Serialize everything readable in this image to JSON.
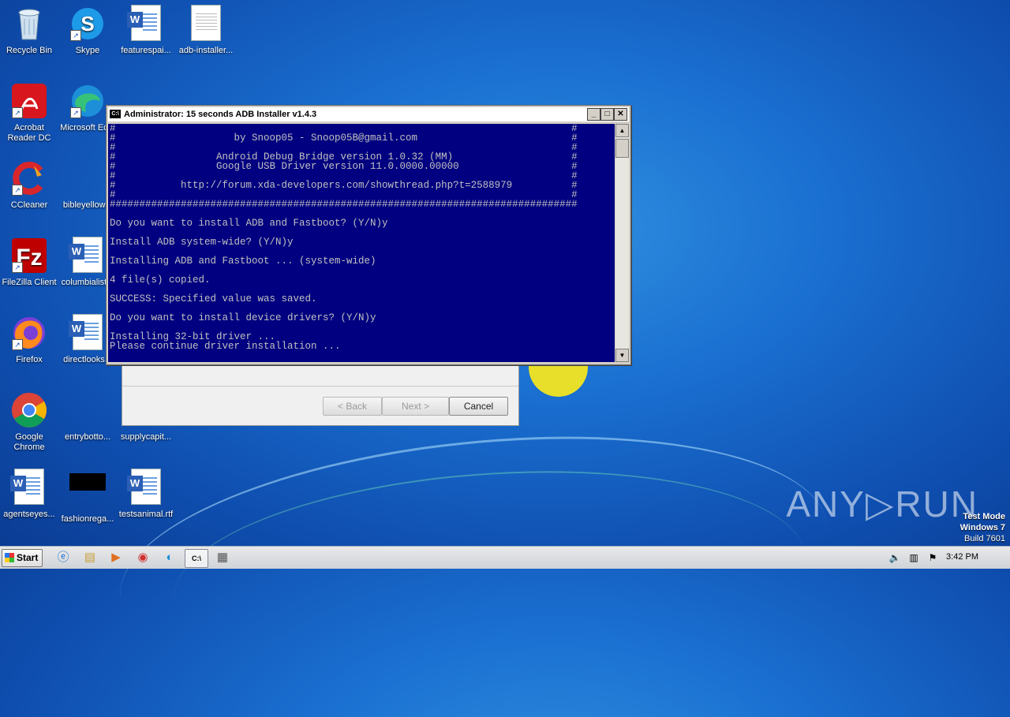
{
  "desktop": {
    "icons": [
      {
        "label": "Recycle Bin",
        "icon": "recycle-bin-icon"
      },
      {
        "label": "Skype",
        "icon": "skype-icon"
      },
      {
        "label": "featurespai...",
        "icon": "word-document-icon"
      },
      {
        "label": "adb-installer...",
        "icon": "text-file-icon"
      },
      {
        "label": "Acrobat Reader DC",
        "icon": "acrobat-icon"
      },
      {
        "label": "Microsoft Ec...",
        "icon": "edge-icon"
      },
      {
        "label": "CCleaner",
        "icon": "ccleaner-icon"
      },
      {
        "label": "bibleyellow...",
        "icon": "file-icon"
      },
      {
        "label": "FileZilla Client",
        "icon": "filezilla-icon"
      },
      {
        "label": "columbialist...",
        "icon": "word-document-icon"
      },
      {
        "label": "Firefox",
        "icon": "firefox-icon"
      },
      {
        "label": "directlooks...",
        "icon": "word-document-icon"
      },
      {
        "label": "Google Chrome",
        "icon": "chrome-icon"
      },
      {
        "label": "entrybotto...",
        "icon": "file-icon"
      },
      {
        "label": "supplycapit...",
        "icon": "file-icon"
      },
      {
        "label": "agentseyes...",
        "icon": "word-document-icon"
      },
      {
        "label": "fashionrega...",
        "icon": "black-file-icon"
      },
      {
        "label": "testsanimal.rtf",
        "icon": "word-document-icon"
      }
    ]
  },
  "console": {
    "title": "Administrator:  15 seconds ADB Installer v1.4.3",
    "minimize": "_",
    "maximize": "□",
    "close": "✕",
    "lines": [
      "#                                                                             #",
      "#                    by Snoop05 - Snoop05B@gmail.com                          #",
      "#                                                                             #",
      "#                 Android Debug Bridge version 1.0.32 (MM)                    #",
      "#                 Google USB Driver version 11.0.0000.00000                   #",
      "#                                                                             #",
      "#           http://forum.xda-developers.com/showthread.php?t=2588979          #",
      "#                                                                             #",
      "###############################################################################",
      "",
      "Do you want to install ADB and Fastboot? (Y/N)y",
      "",
      "Install ADB system-wide? (Y/N)y",
      "",
      "Installing ADB and Fastboot ... (system-wide)",
      "",
      "4 file(s) copied.",
      "",
      "SUCCESS: Specified value was saved.",
      "",
      "Do you want to install device drivers? (Y/N)y",
      "",
      "Installing 32-bit driver ...",
      "Please continue driver installation ..."
    ]
  },
  "installer": {
    "back": "< Back",
    "next": "Next >",
    "cancel": "Cancel"
  },
  "taskbar": {
    "start": "Start",
    "clock": "3:42 PM"
  },
  "watermark": {
    "brand": "ANY▷RUN",
    "line1": "Test Mode",
    "line2": "Windows 7",
    "line3": "Build 7601"
  }
}
